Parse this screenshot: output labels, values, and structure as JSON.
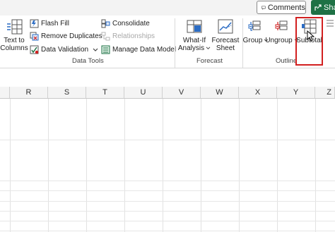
{
  "header": {
    "comments_label": "Comments",
    "share_label": "Sha"
  },
  "ribbon": {
    "data_tools": {
      "text_to_columns_line1": "Text to",
      "text_to_columns_line2": "Columns",
      "flash_fill": "Flash Fill",
      "remove_duplicates": "Remove Duplicates",
      "data_validation": "Data Validation",
      "consolidate": "Consolidate",
      "relationships": "Relationships",
      "manage_data_model": "Manage Data Model",
      "group_label": "Data Tools"
    },
    "forecast": {
      "what_if_line1": "What-If",
      "what_if_line2": "Analysis",
      "forecast_sheet_line1": "Forecast",
      "forecast_sheet_line2": "Sheet",
      "group_label": "Forecast"
    },
    "outline": {
      "group": "Group",
      "ungroup": "Ungroup",
      "subtotal": "Subtotal",
      "group_label": "Outline"
    }
  },
  "columns": [
    "R",
    "S",
    "T",
    "U",
    "V",
    "W",
    "X",
    "Y",
    "Z"
  ],
  "colors": {
    "accent": "#1e7145",
    "highlight": "#d21f1f"
  }
}
